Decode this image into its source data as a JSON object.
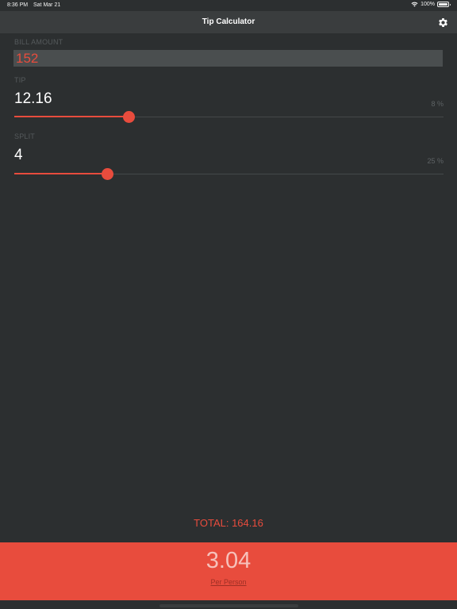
{
  "status_bar": {
    "time": "8:36 PM",
    "date": "Sat Mar 21",
    "battery": "100%"
  },
  "nav": {
    "title": "Tip Calculator",
    "settings_icon": "gear-icon"
  },
  "bill": {
    "label": "BILL AMOUNT",
    "value": "152"
  },
  "tip": {
    "label": "TIP",
    "amount": "12.16",
    "percent_label": "8 %",
    "slider_fraction": 0.267
  },
  "split": {
    "label": "SPLIT",
    "count": "4",
    "percent_label": "25 %",
    "slider_fraction": 0.217
  },
  "total": {
    "text": "TOTAL: 164.16"
  },
  "per_person": {
    "value": "3.04",
    "label": "Per Person"
  },
  "colors": {
    "accent": "#e84c3d",
    "background": "#2c2f30",
    "nav_background": "#3a3d3e"
  }
}
